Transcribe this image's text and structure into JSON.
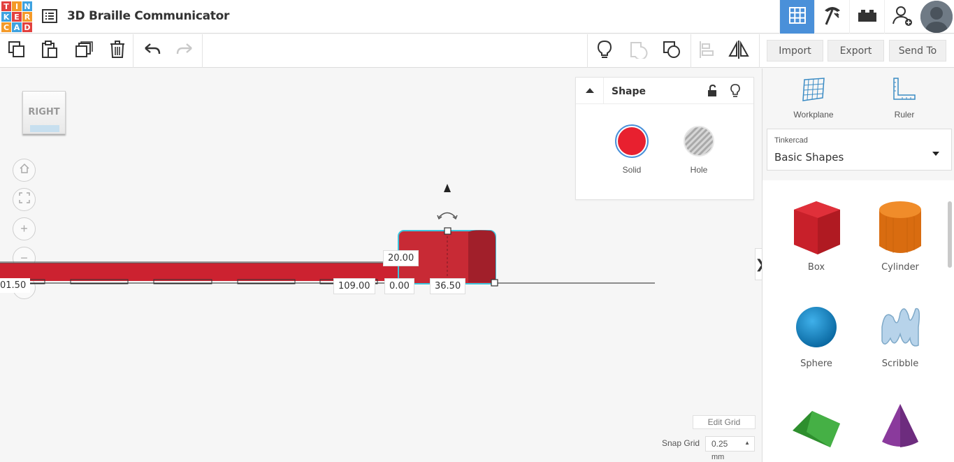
{
  "app": {
    "logo_letters": [
      "T",
      "I",
      "N",
      "K",
      "E",
      "R",
      "C",
      "A",
      "D"
    ],
    "logo_colors": [
      "#e2413f",
      "#f49a29",
      "#3ea2e0",
      "#3ea2e0",
      "#e2413f",
      "#f49a29",
      "#f49a29",
      "#3ea2e0",
      "#e2413f"
    ],
    "title": "3D Braille Communicator"
  },
  "toolbar": {
    "import_label": "Import",
    "export_label": "Export",
    "sendto_label": "Send To"
  },
  "viewcube": {
    "face_label": "RIGHT"
  },
  "shape_panel": {
    "title": "Shape",
    "solid_label": "Solid",
    "hole_label": "Hole",
    "solid_color": "#e8202f"
  },
  "dimensions": {
    "height": "20.00",
    "left_value": "01.50",
    "offset_value": "109.00",
    "elevation": "0.00",
    "width": "36.50"
  },
  "right_panel": {
    "workplane_label": "Workplane",
    "ruler_label": "Ruler",
    "library_source": "Tinkercad",
    "library_name": "Basic Shapes",
    "shapes": [
      {
        "label": "Box",
        "color": "#d0202a"
      },
      {
        "label": "Cylinder",
        "color": "#e57b14"
      },
      {
        "label": "Sphere",
        "color": "#1a8ac9"
      },
      {
        "label": "Scribble",
        "color": "#a8c8e0"
      },
      {
        "label": "Roof",
        "color": "#3aa53a"
      },
      {
        "label": "Cone",
        "color": "#8e3fa0"
      }
    ]
  },
  "bottom": {
    "edit_grid_label": "Edit Grid",
    "snap_grid_label": "Snap Grid",
    "snap_value": "0.25",
    "snap_unit": "mm"
  }
}
